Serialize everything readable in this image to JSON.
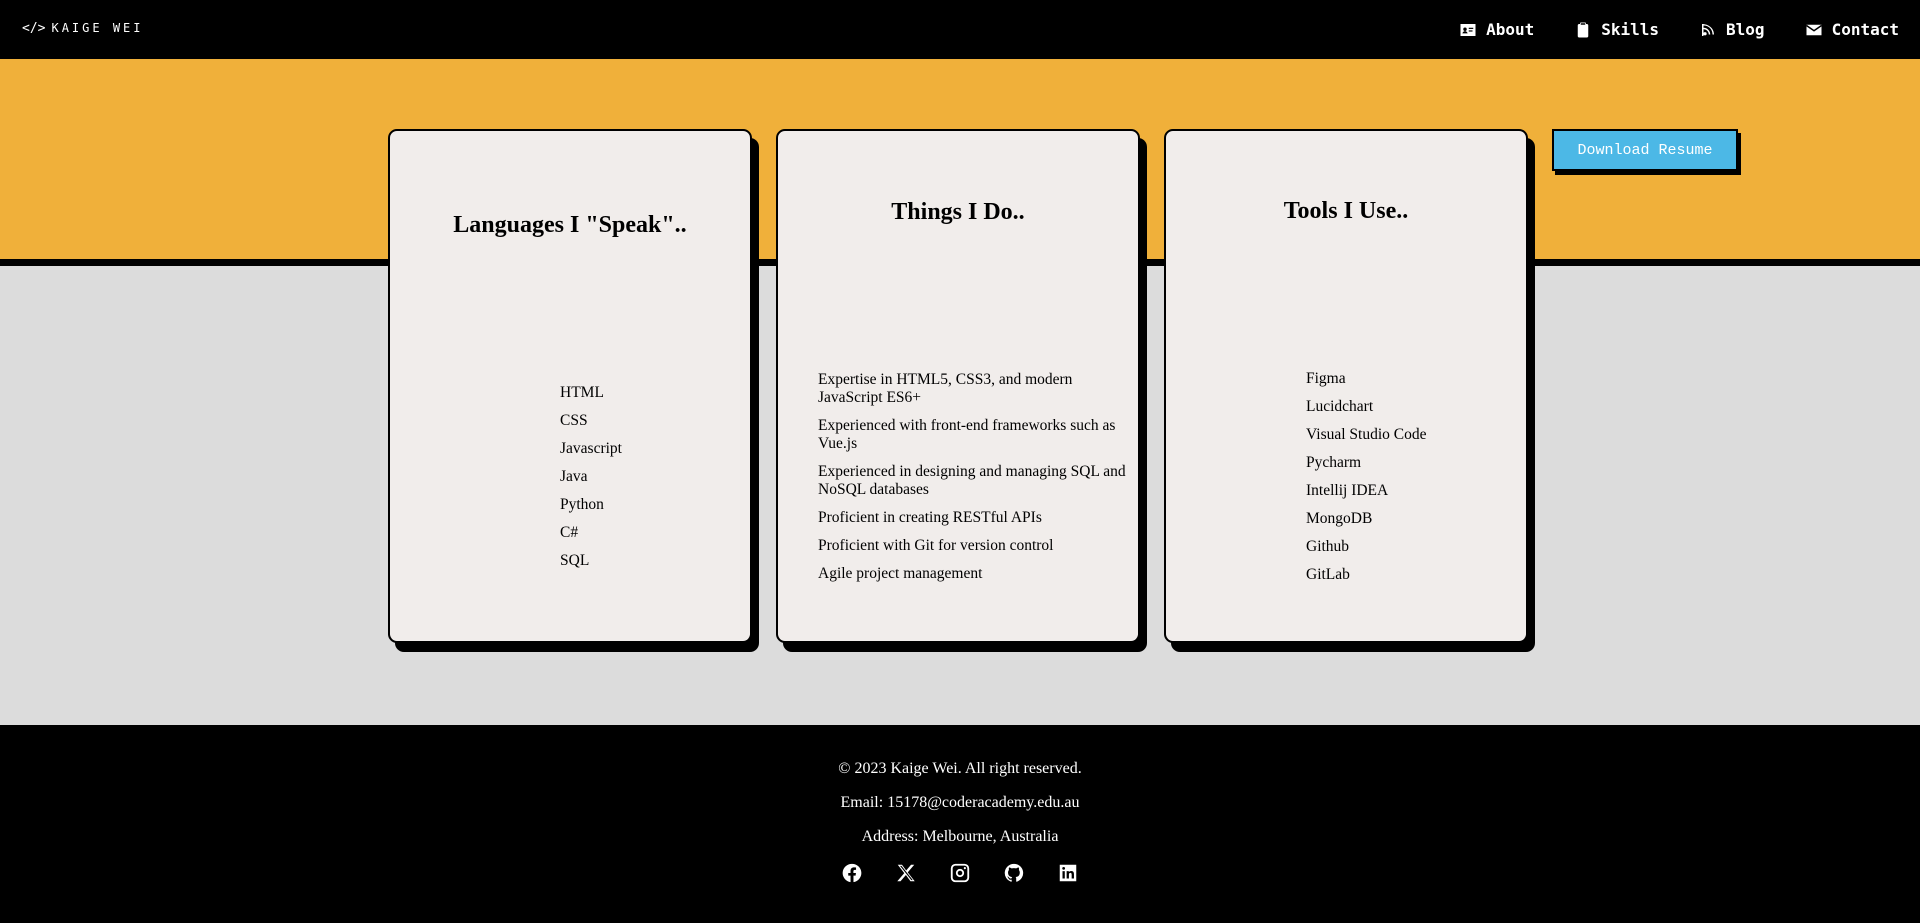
{
  "nav": {
    "logo_mark": "</>",
    "logo_text": "KAIGE WEI",
    "links": [
      {
        "label": "About",
        "icon": "id-card-icon"
      },
      {
        "label": "Skills",
        "icon": "clipboard-icon"
      },
      {
        "label": "Blog",
        "icon": "blog-icon"
      },
      {
        "label": "Contact",
        "icon": "envelope-icon"
      }
    ]
  },
  "cards": [
    {
      "title": "Languages I \"Speak\"..",
      "items": [
        "HTML",
        "CSS",
        "Javascript",
        "Java",
        "Python",
        "C#",
        "SQL"
      ]
    },
    {
      "title": "Things I Do..",
      "items": [
        "Expertise in HTML5, CSS3, and modern JavaScript ES6+",
        "Experienced with front-end frameworks such as Vue.js",
        "Experienced in designing and managing SQL and NoSQL databases",
        "Proficient in creating RESTful APIs",
        "Proficient with Git for version control",
        "Agile project management"
      ]
    },
    {
      "title": "Tools I Use..",
      "items": [
        "Figma",
        "Lucidchart",
        "Visual Studio Code",
        "Pycharm",
        "Intellij IDEA",
        "MongoDB",
        "Github",
        "GitLab"
      ]
    }
  ],
  "resume_button": "Download Resume",
  "footer": {
    "copyright": "© 2023 Kaige Wei. All right reserved.",
    "email": "Email: 15178@coderacademy.edu.au",
    "address": "Address: Melbourne, Australia",
    "socials": [
      "facebook-icon",
      "x-icon",
      "instagram-icon",
      "github-icon",
      "linkedin-icon"
    ]
  },
  "colors": {
    "nav_bg": "#000000",
    "band": "#f0b03a",
    "page_bg": "#dcdcdc",
    "card_bg": "#f1edeb",
    "button": "#4cb8e6"
  }
}
